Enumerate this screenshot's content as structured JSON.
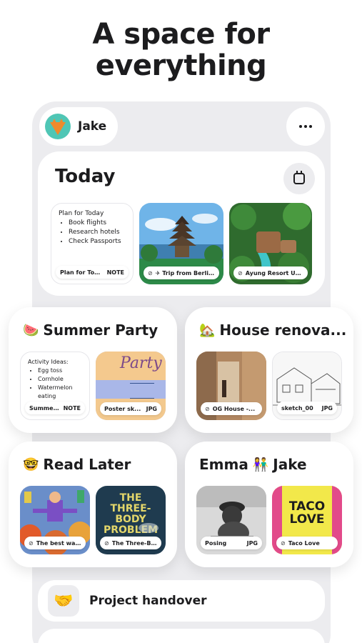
{
  "headline": {
    "line1": "A space for",
    "line2": "everything"
  },
  "user": {
    "name": "Jake",
    "avatar_icon": "fox-icon"
  },
  "more_icon": "more-dots-icon",
  "today": {
    "title": "Today",
    "calendar_icon": "calendar-icon",
    "note": {
      "heading": "Plan for Today",
      "items": [
        "Book flights",
        "Research hotels",
        "Check Passports"
      ],
      "label": "Plan for Tod...",
      "type": "NOTE"
    },
    "links": [
      {
        "label": "✈ Trip from Berli...",
        "icon": "link-icon"
      },
      {
        "label": "Ayung Resort Ub...",
        "icon": "link-icon"
      }
    ]
  },
  "summer": {
    "emoji": "🍉",
    "title": "Summer Party",
    "note": {
      "heading": "Activity Ideas:",
      "items": [
        "Egg toss",
        "Cornhole",
        "Watermelon eating contest..."
      ],
      "label": "Summer...",
      "type": "NOTE"
    },
    "image": {
      "art_text": "Party",
      "label": "Poster sk...",
      "type": "JPG"
    }
  },
  "house": {
    "emoji": "🏡",
    "title": "House renova...",
    "link": {
      "label": "OG House -..."
    },
    "image": {
      "label": "sketch_00",
      "type": "JPG"
    }
  },
  "read_later": {
    "emoji": "🤓",
    "title": "Read Later",
    "links": [
      {
        "label": "The best wa..."
      },
      {
        "label": "The Three-B...",
        "art_text": "THE THREE-BODY PROBLEM"
      }
    ]
  },
  "emma": {
    "title_left": "Emma",
    "emoji": "👫",
    "title_right": "Jake",
    "image": {
      "label": "Posing",
      "type": "JPG"
    },
    "link": {
      "label": "Taco Love",
      "art_text": "TACO LOVE"
    }
  },
  "project": {
    "emoji": "🤝",
    "label": "Project handover"
  }
}
